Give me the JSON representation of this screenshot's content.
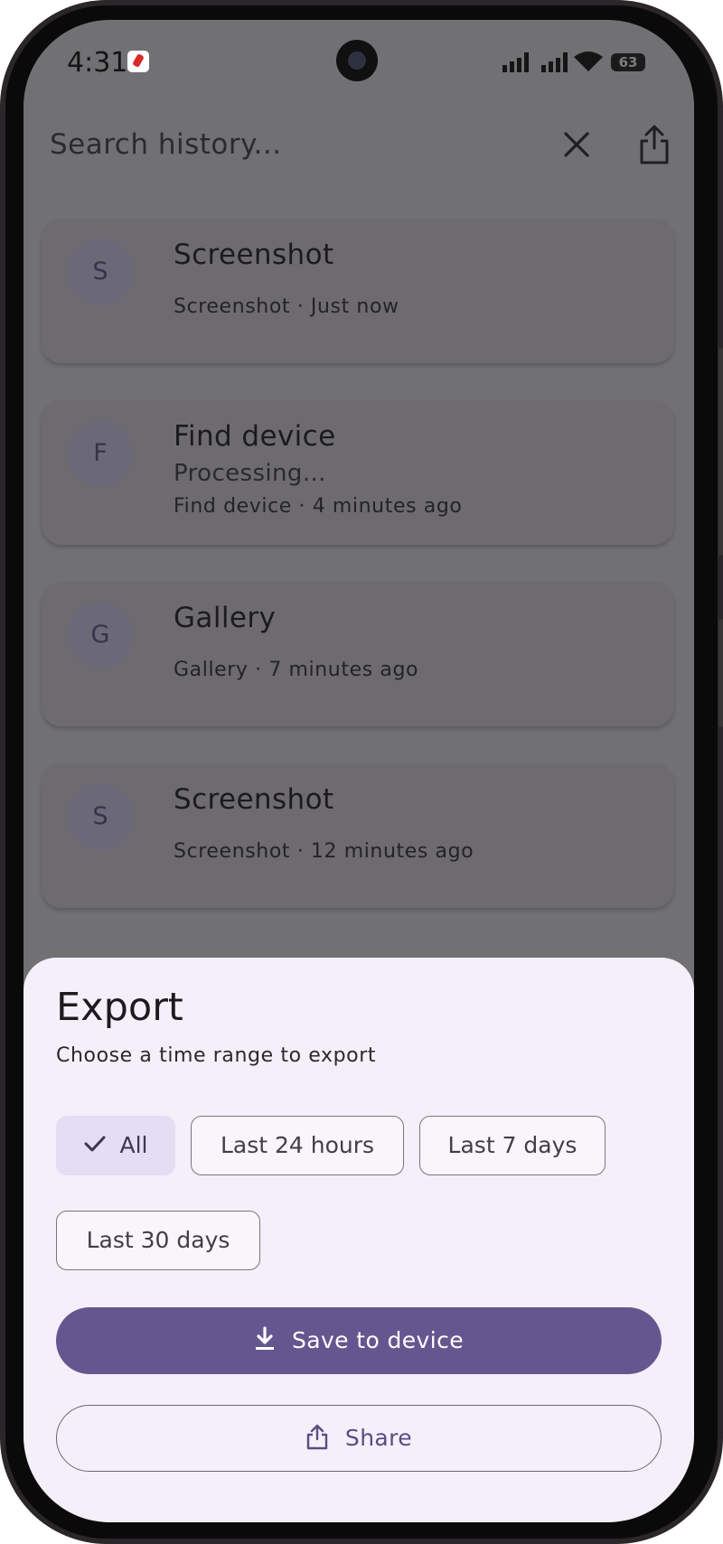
{
  "status_bar": {
    "time": "4:31",
    "battery": "63"
  },
  "app_bar": {
    "search_placeholder": "Search history...",
    "close_icon": "close-icon",
    "share_icon": "share-icon"
  },
  "history": [
    {
      "initial": "S",
      "title": "Screenshot",
      "status": "",
      "meta": "Screenshot · Just now"
    },
    {
      "initial": "F",
      "title": "Find device",
      "status": "Processing...",
      "meta": "Find device · 4 minutes ago"
    },
    {
      "initial": "G",
      "title": "Gallery",
      "status": "",
      "meta": "Gallery · 7 minutes ago"
    },
    {
      "initial": "S",
      "title": "Screenshot",
      "status": "",
      "meta": "Screenshot · 12 minutes ago"
    }
  ],
  "export_sheet": {
    "title": "Export",
    "subtitle": "Choose a time range to export",
    "ranges": [
      {
        "label": "All",
        "selected": true
      },
      {
        "label": "Last 24 hours",
        "selected": false
      },
      {
        "label": "Last 7 days",
        "selected": false
      },
      {
        "label": "Last 30 days",
        "selected": false
      }
    ],
    "save_label": "Save to device",
    "share_label": "Share"
  },
  "colors": {
    "primary": "#66568f",
    "sheet_bg": "#f4eff8",
    "scrim": "#717073",
    "chip_selected": "#e5ddf4"
  }
}
